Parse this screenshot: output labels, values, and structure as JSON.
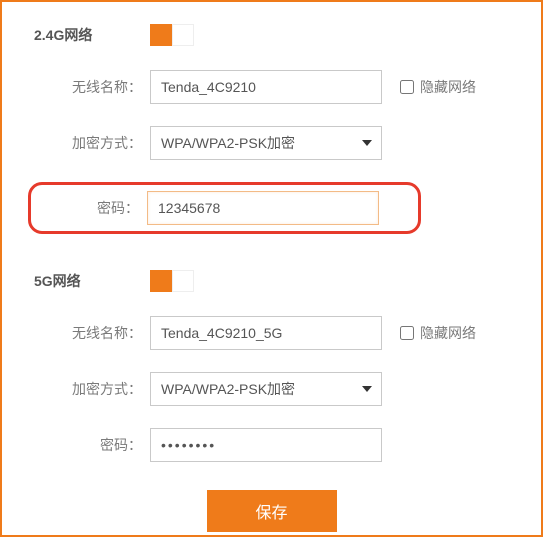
{
  "colors": {
    "accent": "#ef7b1a",
    "highlight_border": "#e63a2b"
  },
  "band24": {
    "title": "2.4G网络",
    "enabled": true,
    "ssid_label": "无线名称：",
    "ssid_value": "Tenda_4C9210",
    "hide_label": "隐藏网络",
    "hide_checked": false,
    "enc_label": "加密方式：",
    "enc_value": "WPA/WPA2-PSK加密",
    "pwd_label": "密码：",
    "pwd_value": "12345678"
  },
  "band5": {
    "title": "5G网络",
    "enabled": true,
    "ssid_label": "无线名称：",
    "ssid_value": "Tenda_4C9210_5G",
    "hide_label": "隐藏网络",
    "hide_checked": false,
    "enc_label": "加密方式：",
    "enc_value": "WPA/WPA2-PSK加密",
    "pwd_label": "密码：",
    "pwd_value": "••••••••"
  },
  "save_label": "保存"
}
